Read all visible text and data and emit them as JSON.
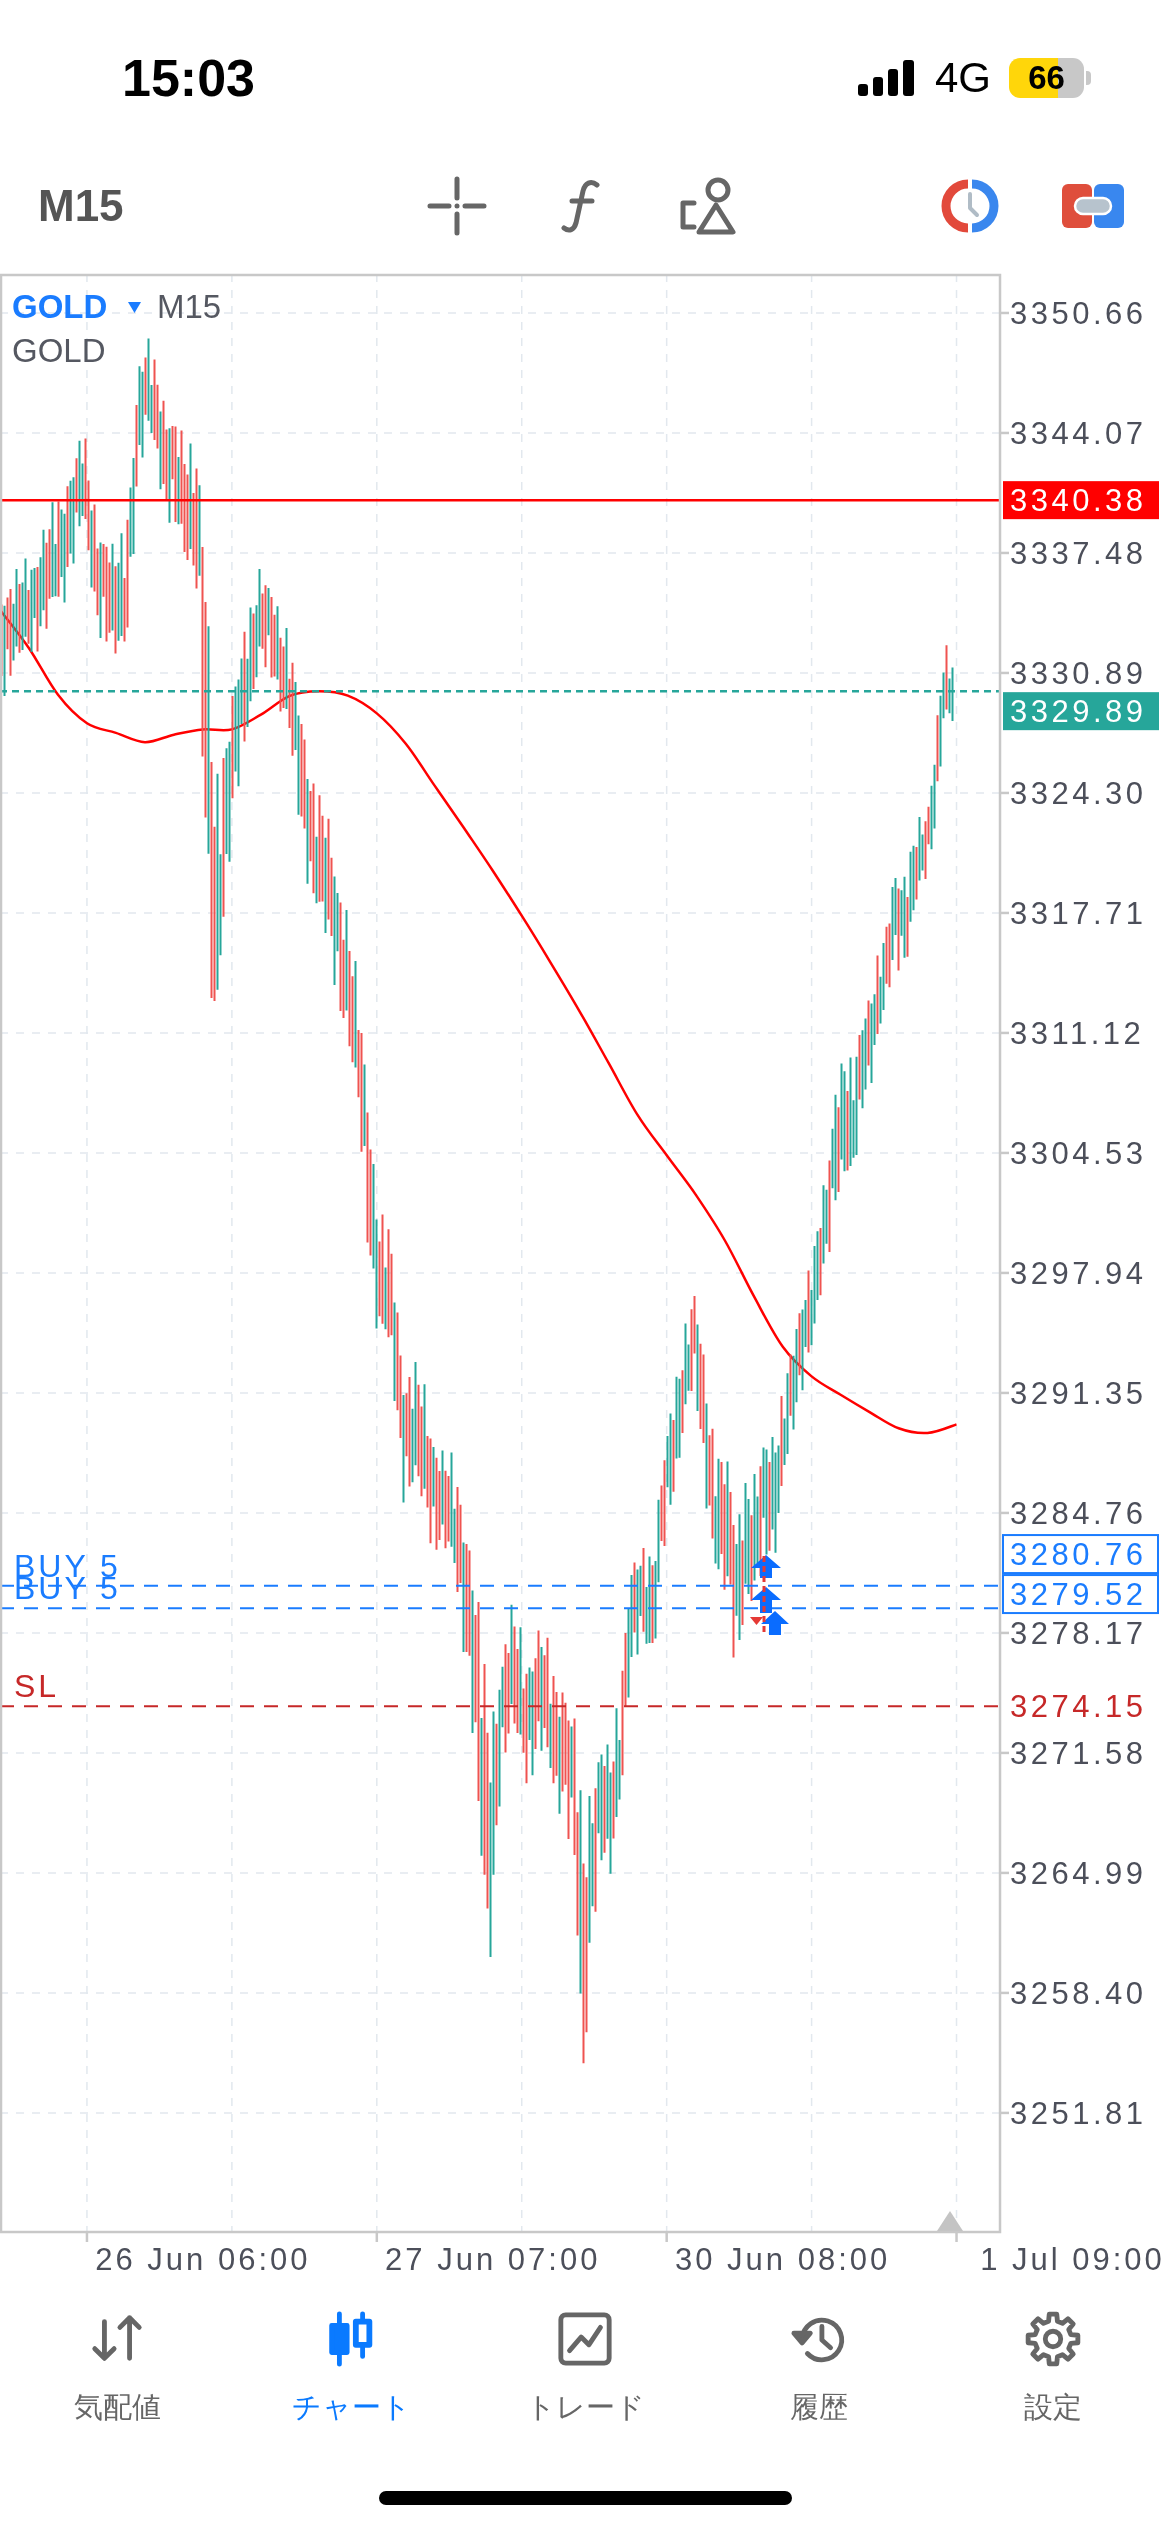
{
  "status_bar": {
    "time": "15:03",
    "network": "4G",
    "battery": "66"
  },
  "toolbar": {
    "timeframe": "M15"
  },
  "chart": {
    "symbol": "GOLD",
    "timeframe": "M15",
    "description": "GOLD",
    "chart_data": {
      "type": "line",
      "grid": true,
      "categories": [
        null,
        null,
        null,
        null,
        null,
        null,
        null,
        "26 Jun 06:00",
        null,
        null,
        null,
        null,
        null,
        null,
        null,
        null,
        null,
        "27 Jun 07:00",
        null,
        null,
        null,
        null,
        null,
        null,
        null,
        null,
        null,
        "30 Jun 08:00",
        null,
        null,
        null,
        null,
        null,
        null,
        null,
        null,
        null,
        "1 Jul 09:00"
      ],
      "series": [
        {
          "color": "#ff0000",
          "values": [
            3334.35,
            3332.25,
            3329.69,
            3328.13,
            3327.6,
            3327.09,
            3327.5,
            3327.79,
            3327.79,
            3328.6,
            3329.63,
            3329.88,
            3329.64,
            3328.67,
            3327.0,
            3324.69,
            3322.39,
            3320.03,
            3317.56,
            3314.97,
            3312.3,
            3309.46,
            3306.6,
            3304.4,
            3302.24,
            3299.75,
            3296.69,
            3293.9,
            3292.26,
            3291.25,
            3290.3,
            3289.41,
            3289.15,
            3289.62,
            null,
            null,
            null,
            null
          ]
        }
      ],
      "ylim": [
        3245.27,
        3352.8
      ],
      "yticks": [
        {
          "value": 3350.66,
          "label": "3350.66"
        },
        {
          "value": 3344.07,
          "label": "3344.07"
        },
        {
          "value": 3337.48,
          "label": "3337.48"
        },
        {
          "value": 3330.89,
          "label": "3330.89"
        },
        {
          "value": 3324.3,
          "label": "3324.30"
        },
        {
          "value": 3317.71,
          "label": "3317.71"
        },
        {
          "value": 3311.12,
          "label": "3311.12"
        },
        {
          "value": 3304.53,
          "label": "3304.53"
        },
        {
          "value": 3297.94,
          "label": "3297.94"
        },
        {
          "value": 3291.35,
          "label": "3291.35"
        },
        {
          "value": 3284.76,
          "label": "3284.76"
        },
        {
          "value": 3278.17,
          "label": "3278.17"
        },
        {
          "value": 3271.58,
          "label": "3271.58"
        },
        {
          "value": 3264.99,
          "label": "3264.99"
        },
        {
          "value": 3258.4,
          "label": "3258.40"
        },
        {
          "value": 3251.81,
          "label": "3251.81"
        }
      ]
    },
    "price_lines": [
      {
        "kind": "alert",
        "price": "3340.38",
        "color": "#ff0000"
      },
      {
        "kind": "bid",
        "price": "3329.89",
        "color": "#26a69a"
      },
      {
        "kind": "order",
        "label": "BUY 5",
        "price": "3280.76",
        "color": "#1a7cff"
      },
      {
        "kind": "order",
        "label": "BUY 5",
        "price": "3279.52",
        "color": "#1a7cff"
      },
      {
        "kind": "stop_loss",
        "label": "SL",
        "price": "3274.15",
        "color": "#c62828"
      }
    ]
  },
  "tabs": [
    {
      "label": "気配値",
      "selected": false
    },
    {
      "label": "チャート",
      "selected": true
    },
    {
      "label": "トレード",
      "selected": false
    },
    {
      "label": "履歴",
      "selected": false
    },
    {
      "label": "設定",
      "selected": false
    }
  ]
}
